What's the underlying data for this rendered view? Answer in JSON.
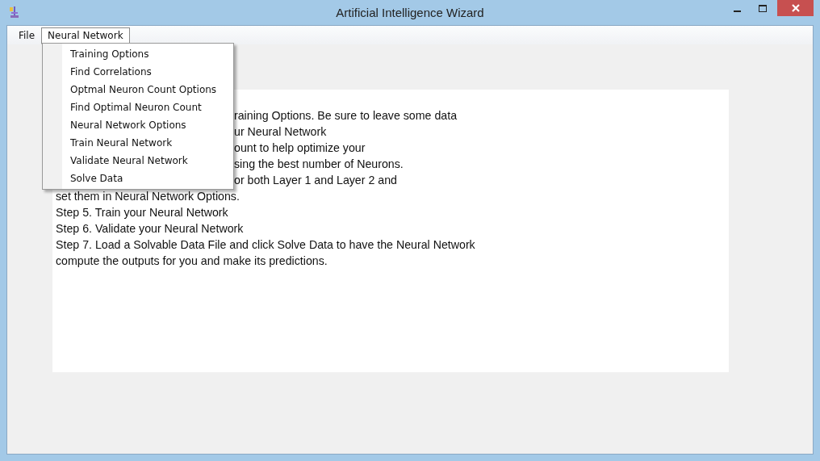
{
  "window": {
    "title": "Artificial Intelligence Wizard"
  },
  "menubar": [
    {
      "label": "File",
      "selected": false
    },
    {
      "label": "Neural Network",
      "selected": true
    }
  ],
  "menu": {
    "items": [
      "Training Options",
      "Find Correlations",
      "Optmal Neuron Count Options",
      "Find Optimal Neuron Count",
      "Neural Network Options",
      "Train Neural Network",
      "Validate Neural Network",
      "Solve Data"
    ]
  },
  "instructions": [
    {
      "text": "raining Options. Be sure to leave some data",
      "kind": "partial"
    },
    {
      "text": "ur Neural Network",
      "kind": "partial"
    },
    {
      "text": "ount to help optimize your",
      "kind": "partial"
    },
    {
      "text": "sing the best number of Neurons.",
      "kind": "partial"
    },
    {
      "text": "or both Layer 1 and Layer 2 and",
      "kind": "partial"
    },
    {
      "text": "set them in Neural Network Options.",
      "kind": "full"
    },
    {
      "text": "Step 5. Train your Neural Network",
      "kind": "full"
    },
    {
      "text": "Step 6. Validate your Neural Network",
      "kind": "full"
    },
    {
      "text": "Step 7. Load a Solvable Data File and click Solve Data to have the Neural Network",
      "kind": "full"
    },
    {
      "text": "compute the outputs for you and make its predictions.",
      "kind": "full"
    }
  ]
}
